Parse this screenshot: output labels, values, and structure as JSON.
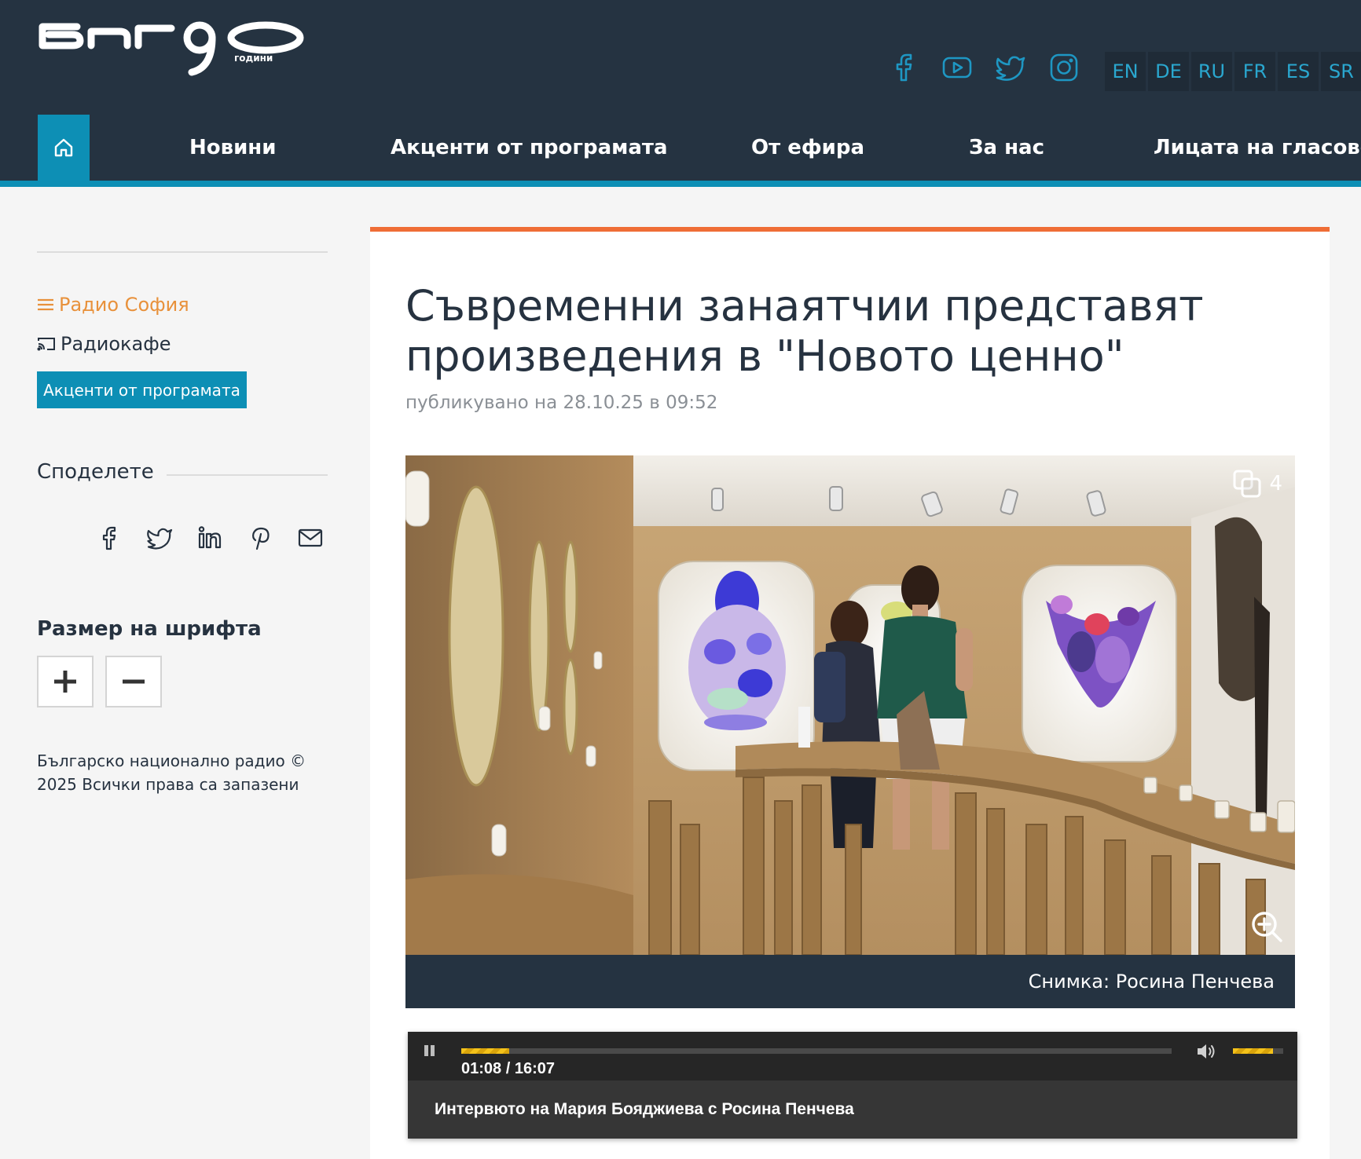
{
  "header": {
    "logo_text": "БНР 90 години",
    "languages": [
      "EN",
      "DE",
      "RU",
      "FR",
      "ES",
      "SR"
    ],
    "socials": [
      "facebook-icon",
      "youtube-icon",
      "twitter-icon",
      "instagram-icon"
    ],
    "nav": [
      "Новини",
      "Акценти от програмата",
      "От ефира",
      "За нас",
      "Лицата на гласовете"
    ]
  },
  "sidebar": {
    "radio_link": "Радио София",
    "cafe_link": "Радиокафе",
    "accent_button": "Акценти от програмата",
    "share_title": "Споделете",
    "share_icons": [
      "facebook-icon",
      "twitter-icon",
      "linkedin-icon",
      "pinterest-icon",
      "mail-icon"
    ],
    "font_size_title": "Размер на шрифта",
    "copyright": "Българско национално радио © 2025 Всички права са запазени"
  },
  "article": {
    "title": "Съвременни занаятчии представят произведения в \"Новото ценно\"",
    "published": "публикувано на 28.10.25 в 09:52",
    "gallery_count": "4",
    "caption": "Снимка: Росина Пенчева"
  },
  "player": {
    "time": "01:08 / 16:07",
    "progress": 0.067,
    "volume": 0.8,
    "track_title": "Интервюто на Мария Бояджиева с Росина Пенчева"
  },
  "colors": {
    "header_bg": "#253341",
    "accent_blue": "#0d8fb5",
    "accent_orange": "#ef6d36",
    "radio_orange": "#e8913b",
    "player_yellow": "#f4c21a"
  }
}
